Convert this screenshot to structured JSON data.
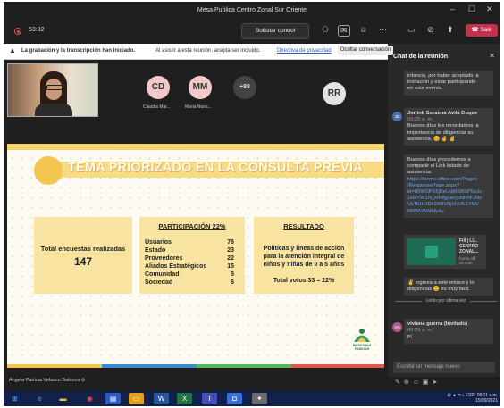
{
  "window": {
    "title": "Mesa Publica Centro Zonal Sur Oriente"
  },
  "toolbar": {
    "timer": "53:32",
    "request_control": "Solicitar control",
    "leave": "Salir",
    "tooltip": "Ocultar conversación"
  },
  "banner": {
    "bold": "La grabación y la transcripción han iniciado.",
    "text": "Al asistir a esta reunión, acepta ser incluido.",
    "link": "Directiva de privacidad"
  },
  "participants": [
    {
      "initials": "CD",
      "name": "Claudia Mar...",
      "color": "#f2c9c9"
    },
    {
      "initials": "MM",
      "name": "Maria Nues...",
      "color": "#f2c9c9"
    },
    {
      "initials": "+88",
      "name": "",
      "color": "#444444"
    },
    {
      "initials": "RR",
      "name": "",
      "color": "#e3e3e3"
    }
  ],
  "slide": {
    "topic": "TEMA PRIORIZADO EN LA CONSULTA PREVIA",
    "total_label": "Total encuestas realizadas",
    "total_value": "147",
    "participation_header": "PARTICIPACIÓN 22%",
    "participation_rows": [
      {
        "label": "Usuarios",
        "value": "76"
      },
      {
        "label": "Estado",
        "value": "23"
      },
      {
        "label": "Proveedores",
        "value": "22"
      },
      {
        "label": "Aliados Estratégicos",
        "value": "15"
      },
      {
        "label": "Comunidad",
        "value": "5"
      },
      {
        "label": "Sociedad",
        "value": "6"
      }
    ],
    "result_header": "RESULTADO",
    "result_lines": [
      "Políticas y líneas de acción",
      "para la atención integral de",
      "niños y niñas de 0 a 5 años"
    ],
    "result_total": "Total votos 33 = 22%",
    "logo_text": "BIENESTAR FAMILIAR"
  },
  "presenter": "Angela Patricia Velasco Bolanos",
  "chat": {
    "title": "Chat de la reunión",
    "msg0_lines": [
      "infancia, por haber aceptado la",
      "invitación y estar participando",
      "en este evento."
    ],
    "msg1_author": "Jorlink Soraima Avila Duque",
    "msg1_time": "09:25 a. m.",
    "msg1_lines": [
      "Buenos días les recordamos la",
      "importancia de diligenciar su",
      "asistencia. 😊 ✌ ✌"
    ],
    "msg2_lines": [
      "Buenos días procedemos a",
      "compartir el Link listado de",
      "asistencia:"
    ],
    "msg2_link": [
      "https://forms.office.com/Pages",
      "/ResponsePage.aspx?",
      "id=86WSPX6jBeUqMXBSP5eJv",
      "1kRYW1N_HN8jyuorjhNhhFJNz",
      "VaTiUHJDk2MllVNjhNVE1YRV",
      "M0WUhWMy4u"
    ],
    "card_title": [
      "Fill | LI...",
      "CENTRO",
      "ZONAL..."
    ],
    "card_source": "forms.offi ce.com",
    "msg3_lines": [
      "✌ ingresa a este enlace y lo",
      "diligencias 😊 es muy facil."
    ],
    "separator": "Leído por última vez",
    "msg4_author": "viviana guerra (Invitado)",
    "msg4_time": "09:29 a. m.",
    "msg4_text": "p(",
    "input_placeholder": "Escribir un mensaje nuevo"
  },
  "taskbar": {
    "time": "09:11 a.m.",
    "date": "15/09/2021",
    "lang": "ESP"
  },
  "colors": {
    "leave": "#c4314b",
    "slide_bg": "#fcfaf2",
    "card": "#f8e3a0",
    "accent": "#f4c64f"
  }
}
